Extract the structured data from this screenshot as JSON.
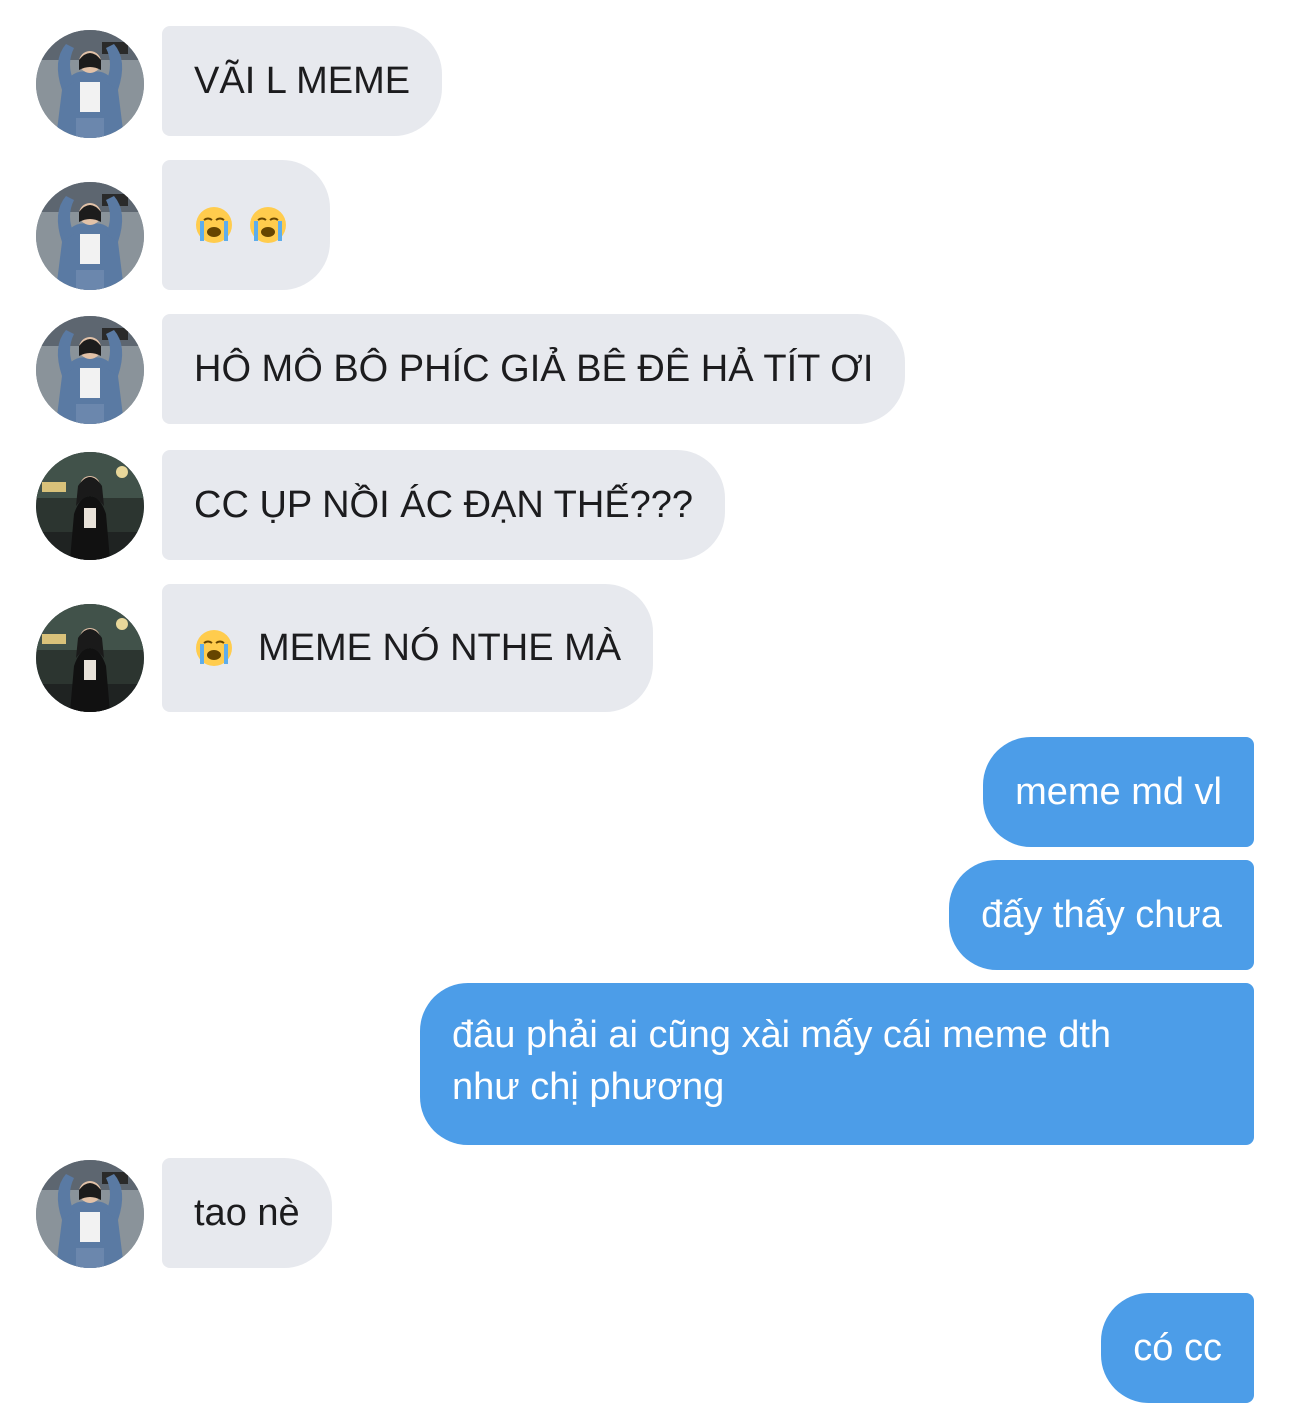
{
  "conversation": {
    "messages": [
      {
        "id": "m1",
        "side": "in",
        "avatar": "avatar-denim-jacket",
        "text": "VÃI L MEME"
      },
      {
        "id": "m2",
        "side": "in",
        "avatar": "avatar-denim-jacket",
        "emojis": [
          "loudly-crying-face-icon",
          "loudly-crying-face-icon"
        ]
      },
      {
        "id": "m3",
        "side": "in",
        "avatar": "avatar-denim-jacket",
        "text": "HÔ MÔ BÔ PHÍC GIẢ BÊ ĐÊ HẢ TÍT ƠI"
      },
      {
        "id": "m4",
        "side": "in",
        "avatar": "avatar-night-street",
        "text": "CC ỤP NỒI ÁC ĐẠN THẾ???"
      },
      {
        "id": "m5",
        "side": "in",
        "avatar": "avatar-night-street",
        "emojis": [
          "loudly-crying-face-icon"
        ],
        "text": "MEME NÓ NTHE MÀ"
      },
      {
        "id": "m6",
        "side": "out",
        "text": "meme md vl"
      },
      {
        "id": "m7",
        "side": "out",
        "text": "đấy thấy chưa"
      },
      {
        "id": "m8",
        "side": "out",
        "lines": [
          "đâu phải ai cũng xài mấy cái meme dth",
          "như chị phương"
        ]
      },
      {
        "id": "m9",
        "side": "in",
        "avatar": "avatar-denim-jacket",
        "text": "tao nè"
      },
      {
        "id": "m10",
        "side": "out",
        "text": "có cc"
      }
    ]
  },
  "colors": {
    "incoming_bubble": "#e7e9ee",
    "outgoing_bubble": "#4c9de8",
    "incoming_text": "#1c1c1e",
    "outgoing_text": "#ffffff",
    "background": "#ffffff"
  }
}
